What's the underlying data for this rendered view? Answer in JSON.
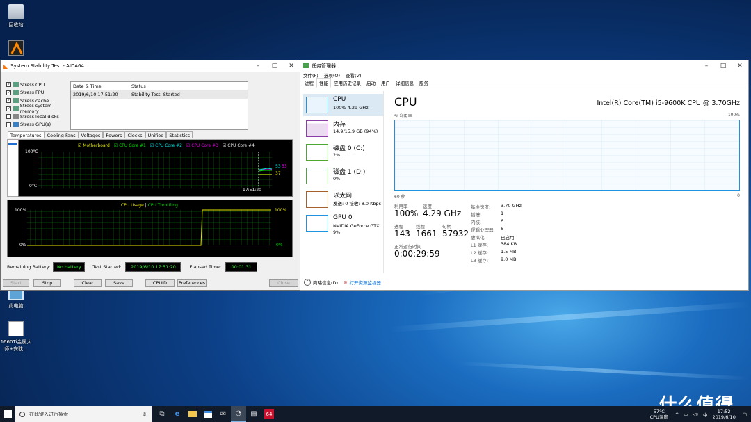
{
  "desktop": {
    "icons": [
      {
        "label": "回收站"
      },
      {
        "label": "此电脑"
      },
      {
        "label": "1660Ti金属大师+安耽..."
      }
    ],
    "watermark": "什么值得买"
  },
  "aida": {
    "title": "System Stability Test - AIDA64",
    "stress": [
      {
        "label": "Stress CPU",
        "checked": true
      },
      {
        "label": "Stress FPU",
        "checked": true
      },
      {
        "label": "Stress cache",
        "checked": true
      },
      {
        "label": "Stress system memory",
        "checked": true
      },
      {
        "label": "Stress local disks",
        "checked": false
      },
      {
        "label": "Stress GPU(s)",
        "checked": false
      }
    ],
    "log": {
      "col_date": "Date & Time",
      "col_status": "Status",
      "rows": [
        {
          "date": "2019/6/10 17:51:20",
          "status": "Stability Test: Started"
        }
      ]
    },
    "tabs": [
      "Temperatures",
      "Cooling Fans",
      "Voltages",
      "Powers",
      "Clocks",
      "Unified",
      "Statistics"
    ],
    "temp_graph": {
      "legend": [
        {
          "label": "Motherboard",
          "color": "#e6e600"
        },
        {
          "label": "CPU Core #1",
          "color": "#00e600"
        },
        {
          "label": "CPU Core #2",
          "color": "#00e6e6"
        },
        {
          "label": "CPU Core #3",
          "color": "#e600e6"
        },
        {
          "label": "CPU Core #4",
          "color": "#e6e6e6"
        }
      ],
      "ymax": "100°C",
      "ymin": "0°C",
      "time": "17:51:20",
      "readings": [
        "53",
        "53",
        "37"
      ]
    },
    "usage_graph": {
      "legend_usage": "CPU Usage",
      "legend_sep": "|",
      "legend_throttle": "CPU Throttling",
      "ymax": "100%",
      "ymin": "0%",
      "rmax": "100%",
      "rmin": "0%"
    },
    "status": {
      "battery_label": "Remaining Battery:",
      "battery_value": "No battery",
      "started_label": "Test Started:",
      "started_value": "2019/6/10 17:51:20",
      "elapsed_label": "Elapsed Time:",
      "elapsed_value": "00:01:31"
    },
    "buttons": {
      "start": "Start",
      "stop": "Stop",
      "clear": "Clear",
      "save": "Save",
      "cpuid": "CPUID",
      "preferences": "Preferences",
      "close": "Close"
    }
  },
  "tm": {
    "title": "任务管理器",
    "menu": [
      "文件(F)",
      "选项(O)",
      "查看(V)"
    ],
    "tabs": [
      "进程",
      "性能",
      "应用历史记录",
      "启动",
      "用户",
      "详细信息",
      "服务"
    ],
    "side": [
      {
        "name": "CPU",
        "sub": "100%  4.29 GHz",
        "color": "#1e93e0"
      },
      {
        "name": "内存",
        "sub": "14.9/15.9 GB (94%)",
        "color": "#8b3ea8"
      },
      {
        "name": "磁盘 0 (C:)",
        "sub": "2%",
        "color": "#4da832"
      },
      {
        "name": "磁盘 1 (D:)",
        "sub": "0%",
        "color": "#4da832"
      },
      {
        "name": "以太网",
        "sub": "发送: 0  接收: 8.0 Kbps",
        "color": "#a8602a"
      },
      {
        "name": "GPU 0",
        "sub": "NVIDIA GeForce GTX",
        "sub2": "9%",
        "color": "#1e93e0"
      }
    ],
    "cpu": {
      "title": "CPU",
      "processor": "Intel(R) Core(TM) i5-9600K CPU @ 3.70GHz",
      "graph_label": "% 利用率",
      "graph_max": "100%",
      "graph_time": "60 秒",
      "graph_min": "0",
      "utilization_label": "利用率",
      "utilization": "100%",
      "speed_label": "速度",
      "speed": "4.29 GHz",
      "processes_label": "进程",
      "processes": "143",
      "threads_label": "线程",
      "threads": "1661",
      "handles_label": "句柄",
      "handles": "57932",
      "uptime_label": "正常运行时间",
      "uptime": "0:00:29:59",
      "details": [
        {
          "k": "基准速度:",
          "v": "3.70 GHz"
        },
        {
          "k": "插槽:",
          "v": "1"
        },
        {
          "k": "内核:",
          "v": "6"
        },
        {
          "k": "逻辑处理器:",
          "v": "6"
        },
        {
          "k": "虚拟化:",
          "v": "已启用"
        },
        {
          "k": "L1 缓存:",
          "v": "384 KB"
        },
        {
          "k": "L2 缓存:",
          "v": "1.5 MB"
        },
        {
          "k": "L3 缓存:",
          "v": "9.0 MB"
        }
      ]
    },
    "footer": {
      "less": "简略信息(D)",
      "resmon": "打开资源监视器"
    }
  },
  "taskbar": {
    "search_placeholder": "在此键入进行搜索",
    "tray_temp": "57°C",
    "tray_temp_label": "CPU温度",
    "time": "17:52",
    "date": "2019/6/10"
  }
}
